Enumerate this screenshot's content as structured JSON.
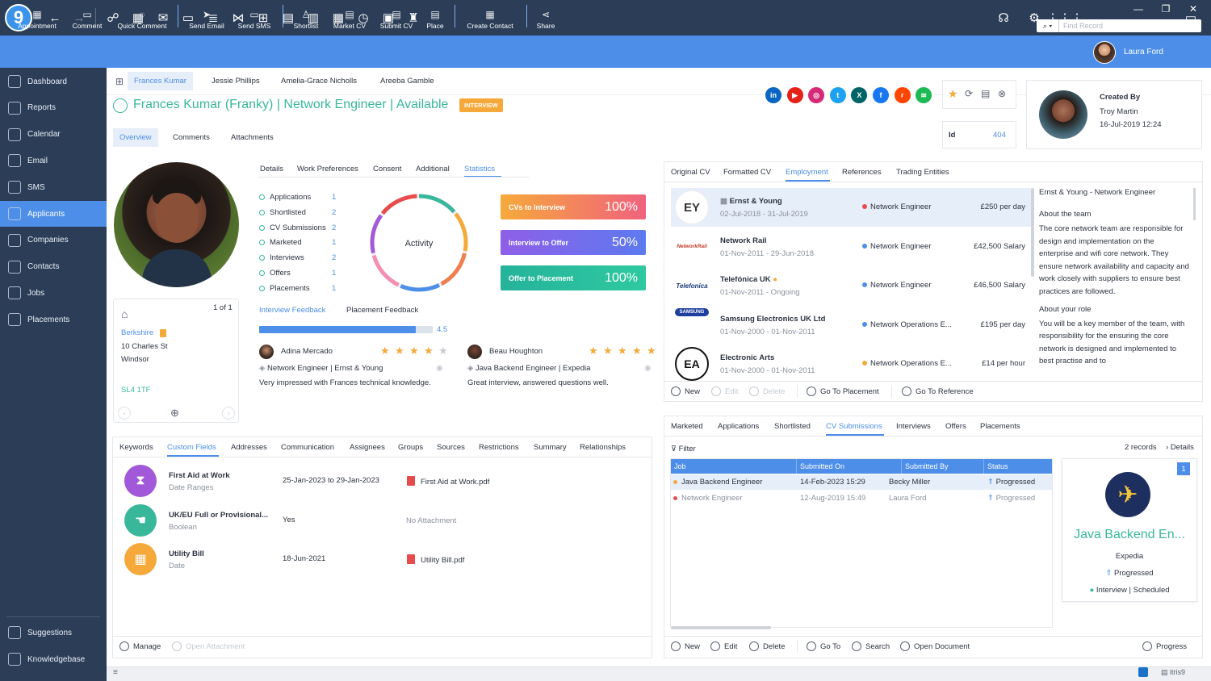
{
  "app": {
    "logo": "9",
    "find_placeholder": "Find Record"
  },
  "titlebar_icons": [
    "back-icon",
    "forward-icon",
    "applicants-icon",
    "calendar-add-icon",
    "email-icon",
    "sms-icon",
    "database-icon",
    "network-icon",
    "add-window-icon",
    "document-icon",
    "cv-icon",
    "form-icon",
    "clock-icon",
    "file-icon",
    "org-icon"
  ],
  "ribbon": {
    "buttons": [
      {
        "label": "Appointment",
        "icon": "calendar-icon"
      },
      {
        "label": "Comment",
        "icon": "comment-icon"
      },
      {
        "label": "Quick Comment",
        "icon": "quick-comment-icon"
      },
      {
        "label": "Send Email",
        "icon": "send-icon"
      },
      {
        "label": "Send SMS",
        "icon": "sms-icon"
      },
      {
        "label": "Shortlist",
        "icon": "shortlist-icon"
      },
      {
        "label": "Market CV",
        "icon": "market-icon"
      },
      {
        "label": "Submit CV",
        "icon": "submit-icon"
      },
      {
        "label": "Place",
        "icon": "place-icon"
      },
      {
        "label": "Create Contact",
        "icon": "contact-icon"
      },
      {
        "label": "Share",
        "icon": "share-icon"
      }
    ],
    "user_name": "Laura Ford"
  },
  "sidebar": {
    "items": [
      {
        "label": "Dashboard",
        "icon": "dashboard-icon"
      },
      {
        "label": "Reports",
        "icon": "reports-icon"
      },
      {
        "label": "Calendar",
        "icon": "calendar-icon"
      },
      {
        "label": "Email",
        "icon": "email-icon"
      },
      {
        "label": "SMS",
        "icon": "sms-icon"
      },
      {
        "label": "Applicants",
        "icon": "applicants-icon"
      },
      {
        "label": "Companies",
        "icon": "companies-icon"
      },
      {
        "label": "Contacts",
        "icon": "contacts-icon"
      },
      {
        "label": "Jobs",
        "icon": "jobs-icon"
      },
      {
        "label": "Placements",
        "icon": "placements-icon"
      }
    ],
    "bottom": [
      {
        "label": "Suggestions",
        "icon": "suggestions-icon"
      },
      {
        "label": "Knowledgebase",
        "icon": "knowledgebase-icon"
      }
    ]
  },
  "record_tabs": [
    "Frances Kumar",
    "Jessie Phillips",
    "Amelia-Grace Nicholls",
    "Areeba Gamble"
  ],
  "record": {
    "name": "Frances Kumar (Franky) | Network Engineer | Available",
    "status_badge": "INTERVIEW",
    "subtabs": [
      "Overview",
      "Comments",
      "Attachments"
    ],
    "social": [
      {
        "name": "linkedin",
        "letter": "in",
        "color": "#0a66c2"
      },
      {
        "name": "youtube",
        "letter": "▶",
        "color": "#e62117"
      },
      {
        "name": "instagram",
        "letter": "◎",
        "color": "#d62976"
      },
      {
        "name": "twitter",
        "letter": "t",
        "color": "#1da1f2"
      },
      {
        "name": "xing",
        "letter": "X",
        "color": "#026466"
      },
      {
        "name": "facebook",
        "letter": "f",
        "color": "#1877f2"
      },
      {
        "name": "reddit",
        "letter": "r",
        "color": "#ff4500"
      },
      {
        "name": "spotify",
        "letter": "≋",
        "color": "#1db954"
      }
    ],
    "id_label": "Id",
    "id_value": "404",
    "created_by_label": "Created By",
    "created_by": "Troy Martin",
    "created_on": "16-Jul-2019 12:24"
  },
  "address": {
    "pager": "1 of 1",
    "name": "Berkshire",
    "line1": "10 Charles St",
    "line2": "Windsor",
    "postcode": "SL4 1TF"
  },
  "detail_tabs": [
    "Details",
    "Work Preferences",
    "Consent",
    "Additional",
    "Statistics"
  ],
  "stats": {
    "items": [
      {
        "label": "Applications",
        "value": "1"
      },
      {
        "label": "Shortlisted",
        "value": "2"
      },
      {
        "label": "CV Submissions",
        "value": "2"
      },
      {
        "label": "Marketed",
        "value": "1"
      },
      {
        "label": "Interviews",
        "value": "2"
      },
      {
        "label": "Offers",
        "value": "1"
      },
      {
        "label": "Placements",
        "value": "1"
      }
    ],
    "donut_label": "Activity",
    "bars": [
      {
        "label": "CVs to Interview",
        "value": "100%"
      },
      {
        "label": "Interview to Offer",
        "value": "50%"
      },
      {
        "label": "Offer to Placement",
        "value": "100%"
      }
    ]
  },
  "feedback": {
    "tabs": [
      "Interview Feedback",
      "Placement Feedback"
    ],
    "score": "4.5",
    "score_fraction": 0.9,
    "reviews": [
      {
        "name": "Adina Mercado",
        "stars": 4,
        "role": "Network Engineer | Ernst & Young",
        "comment": "Very impressed with Frances technical knowledge."
      },
      {
        "name": "Beau Houghton",
        "stars": 5,
        "role": "Java Backend Engineer | Expedia",
        "comment": "Great interview, answered questions well."
      }
    ]
  },
  "custom_tabs": [
    "Keywords",
    "Custom Fields",
    "Addresses",
    "Communication",
    "Assignees",
    "Groups",
    "Sources",
    "Restrictions",
    "Summary",
    "Relationships"
  ],
  "custom_fields": [
    {
      "title": "First Aid at Work",
      "type": "Date Ranges",
      "value": "25-Jan-2023 to 29-Jan-2023",
      "attachment": "First Aid at Work.pdf",
      "color": "#a259d9",
      "icon": "hourglass-icon"
    },
    {
      "title": "UK/EU Full or Provisional...",
      "type": "Boolean",
      "value": "Yes",
      "attachment": "No Attachment",
      "color": "#39b79b",
      "icon": "hand-icon"
    },
    {
      "title": "Utility Bill",
      "type": "Date",
      "value": "18-Jun-2021",
      "attachment": "Utility Bill.pdf",
      "color": "#f6a93b",
      "icon": "calendar-icon"
    }
  ],
  "custom_actions": [
    "Manage",
    "Open Attachment"
  ],
  "cv_tabs": [
    "Original CV",
    "Formatted CV",
    "Employment",
    "References",
    "Trading Entities"
  ],
  "employment": [
    {
      "company": "Ernst & Young",
      "dates": "02-Jul-2018 - 31-Jul-2019",
      "role": "Network Engineer",
      "pay": "£250 per day",
      "dot": "#e84b4b",
      "logo": "EY"
    },
    {
      "company": "Network Rail",
      "dates": "01-Nov-2011 - 29-Jun-2018",
      "role": "Network Engineer",
      "pay": "£42,500 Salary",
      "dot": "#4d8ee9",
      "logo": "NetworkRail"
    },
    {
      "company": "Telefónica UK",
      "dates": "01-Nov-2011 - Ongoing",
      "role": "Network Engineer",
      "pay": "£46,500 Salary",
      "dot": "#4d8ee9",
      "logo": "Telefonica"
    },
    {
      "company": "Samsung Electronics UK Ltd",
      "dates": "01-Nov-2000 - 01-Nov-2011",
      "role": "Network Operations E...",
      "pay": "£195 per day",
      "dot": "#4d8ee9",
      "logo": "SAMSUNG"
    },
    {
      "company": "Electronic Arts",
      "dates": "01-Nov-2000 - 01-Nov-2011",
      "role": "Network Operations E...",
      "pay": "£14 per hour",
      "dot": "#f6a93b",
      "logo": "EA"
    }
  ],
  "employment_detail": {
    "title": "Ernst & Young - Network Engineer",
    "about_team_h": "About the team",
    "about_team": "The core network team are responsible for design and implementation on the enterprise and wifi core network. They ensure network availability and capacity and work closely with suppliers to ensure best practices are followed.",
    "role_h": "About your role",
    "role": "You will be a key member of the team, with responsibility for the ensuring the core network is designed and implemented to best practise and to"
  },
  "employment_actions": [
    "New",
    "Edit",
    "Delete",
    "Go To Placement",
    "Go To Reference"
  ],
  "pipeline_tabs": [
    "Marketed",
    "Applications",
    "Shortlisted",
    "CV Submissions",
    "Interviews",
    "Offers",
    "Placements"
  ],
  "pipeline": {
    "filter": "Filter",
    "records": "2 records",
    "details": "Details",
    "columns": [
      "Job",
      "Submitted On",
      "Submitted By",
      "Status"
    ],
    "rows": [
      {
        "job": "Java Backend Engineer",
        "on": "14-Feb-2023 15:29",
        "by": "Becky Miller",
        "status": "Progressed",
        "dot": "#f6a93b"
      },
      {
        "job": "Network Engineer",
        "on": "12-Aug-2019 15:49",
        "by": "Laura Ford",
        "status": "Progressed",
        "dot": "#e84b4b"
      }
    ],
    "card": {
      "count": "1",
      "job": "Java Backend En...",
      "company": "Expedia",
      "status": "Progressed",
      "interview": "Interview",
      "scheduled": "Scheduled"
    }
  },
  "pipeline_actions": [
    "New",
    "Edit",
    "Delete",
    "Go To",
    "Search",
    "Open Document",
    "Progress"
  ],
  "statusbar": {
    "right": "itris9"
  }
}
